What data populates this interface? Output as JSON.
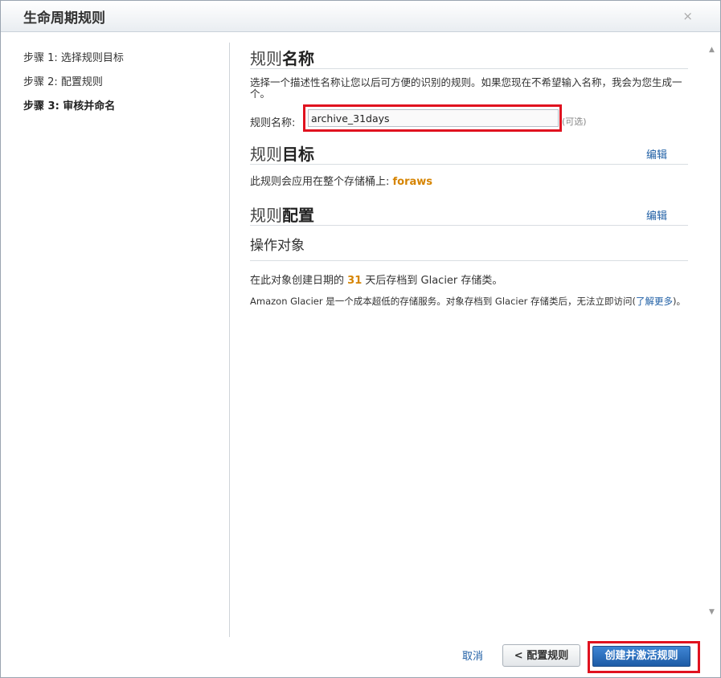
{
  "dialog": {
    "title": "生命周期规则",
    "close_symbol": "×"
  },
  "steps": [
    {
      "label": "步骤 1: 选择规则目标"
    },
    {
      "label": "步骤 2: 配置规则"
    },
    {
      "label": "步骤 3: 审核并命名"
    }
  ],
  "rule_name": {
    "title_prefix": "规则",
    "title_bold": "名称",
    "description": "选择一个描述性名称让您以后可方便的识别的规则。如果您现在不希望输入名称，我会为您生成一个。",
    "field_label": "规则名称:",
    "field_value": "archive_31days",
    "optional_label": "(可选)"
  },
  "rule_target": {
    "title_prefix": "规则",
    "title_bold": "目标",
    "edit_label": "编辑",
    "text_prefix": "此规则会应用在整个存储桶上:",
    "bucket_name": "foraws"
  },
  "rule_config": {
    "title_prefix": "规则",
    "title_bold": "配置",
    "edit_label": "编辑",
    "subheading": "操作对象",
    "archive_prefix": "在此对象创建日期的",
    "archive_days": "31",
    "archive_suffix": "天后存档到 Glacier 存储类。",
    "glacier_note": "Amazon Glacier 是一个成本超低的存储服务。对象存档到 Glacier 存储类后，无法立即访问(",
    "learn_more": "了解更多",
    "glacier_note_end": ")。"
  },
  "footer": {
    "cancel_label": "取消",
    "back_label": "< 配置规则",
    "create_label": "创建并激活规则"
  }
}
